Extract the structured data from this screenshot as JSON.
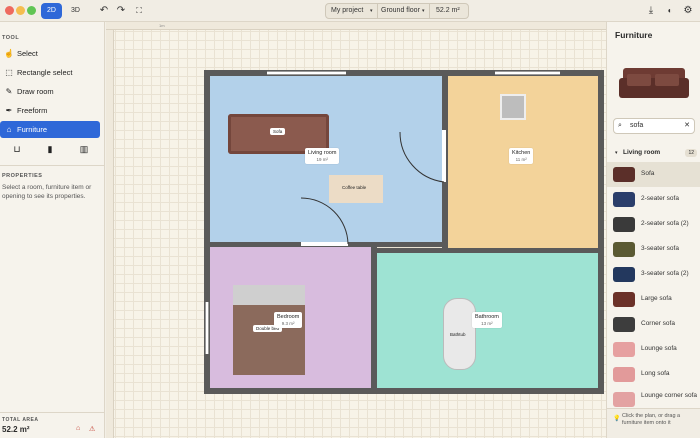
{
  "toolbar": {
    "view_2d": "2D",
    "view_3d": "3D",
    "project": "My project",
    "floor": "Ground floor",
    "area": "52.2 m²",
    "icons": [
      "undo-icon",
      "redo-icon",
      "fit-view-icon",
      "download-icon",
      "user-icon",
      "settings-icon"
    ]
  },
  "left": {
    "tool_title": "TOOL",
    "tools": [
      {
        "label": "Select",
        "icon": "cursor-icon"
      },
      {
        "label": "Rectangle select",
        "icon": "marquee-icon"
      },
      {
        "label": "Draw room",
        "icon": "pencil-icon"
      },
      {
        "label": "Freeform",
        "icon": "pen-icon"
      },
      {
        "label": "Furniture",
        "icon": "sofa-icon"
      }
    ],
    "props_title": "PROPERTIES",
    "props_help": "Select a room, furniture item or opening to see its properties.",
    "total_title": "TOTAL AREA",
    "total_value": "52.2 m²"
  },
  "plan": {
    "rooms": [
      {
        "name": "Living room",
        "area": "19 m²",
        "color": "#b3d1ea"
      },
      {
        "name": "Kitchen",
        "area": "11 m²",
        "color": "#f3d39a"
      },
      {
        "name": "Bedroom",
        "area": "9.3 m²",
        "color": "#d8bcde"
      },
      {
        "name": "Bathroom",
        "area": "13 m²",
        "color": "#9ee3d3"
      }
    ],
    "furniture": {
      "sofa": "Sofa",
      "coffee_table": "Coffee table",
      "double_bed": "Double bed",
      "bathtub": "Bathtub"
    },
    "ruler_mark": "1m"
  },
  "right": {
    "title": "Furniture",
    "search_value": "sofa",
    "group": "Living room",
    "group_count": "12",
    "items": [
      "Sofa",
      "2-seater sofa",
      "2-seater sofa (2)",
      "3-seater sofa",
      "3-seater sofa (2)",
      "Large sofa",
      "Corner sofa",
      "Lounge sofa",
      "Long sofa",
      "Lounge corner sofa"
    ],
    "hint": "Click the plan, or drag a furniture item onto it"
  }
}
